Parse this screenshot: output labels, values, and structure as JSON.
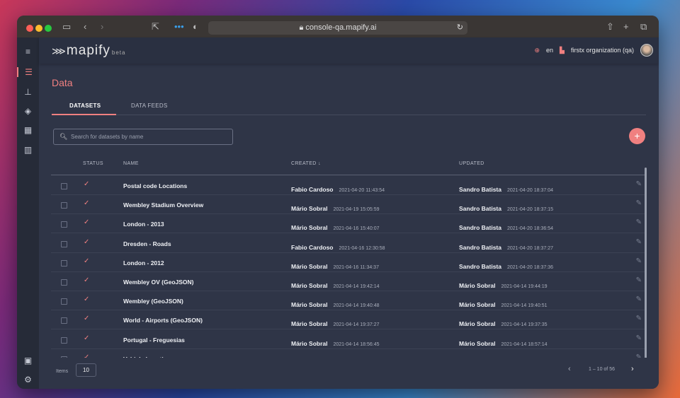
{
  "browser": {
    "url": "console-qa.mapify.ai"
  },
  "app": {
    "logo": "mapify",
    "logo_sub": "beta",
    "language": "en",
    "organization": "firstx organization (qa)"
  },
  "page": {
    "title": "Data",
    "tabs": [
      {
        "label": "DATASETS",
        "active": true
      },
      {
        "label": "DATA FEEDS",
        "active": false
      }
    ],
    "search_placeholder": "Search for datasets by name",
    "add_label": "+"
  },
  "table": {
    "headers": {
      "status": "STATUS",
      "name": "NAME",
      "created": "CREATED",
      "updated": "UPDATED"
    },
    "rows": [
      {
        "name": "Postal code Locations",
        "created_by": "Fabio Cardoso",
        "created_at": "2021-04-20 11:43:54",
        "updated_by": "Sandro Batista",
        "updated_at": "2021-04-20 18:37:04"
      },
      {
        "name": "Wembley Stadium Overview",
        "created_by": "Mário Sobral",
        "created_at": "2021-04-19 15:05:59",
        "updated_by": "Sandro Batista",
        "updated_at": "2021-04-20 18:37:15"
      },
      {
        "name": "London - 2013",
        "created_by": "Mário Sobral",
        "created_at": "2021-04-16 15:40:07",
        "updated_by": "Sandro Batista",
        "updated_at": "2021-04-20 18:36:54"
      },
      {
        "name": "Dresden - Roads",
        "created_by": "Fabio Cardoso",
        "created_at": "2021-04-16 12:30:58",
        "updated_by": "Sandro Batista",
        "updated_at": "2021-04-20 18:37:27"
      },
      {
        "name": "London - 2012",
        "created_by": "Mário Sobral",
        "created_at": "2021-04-16 11:34:37",
        "updated_by": "Sandro Batista",
        "updated_at": "2021-04-20 18:37:36"
      },
      {
        "name": "Wembley OV (GeoJSON)",
        "created_by": "Mário Sobral",
        "created_at": "2021-04-14 19:42:14",
        "updated_by": "Mário Sobral",
        "updated_at": "2021-04-14 19:44:19"
      },
      {
        "name": "Wembley (GeoJSON)",
        "created_by": "Mário Sobral",
        "created_at": "2021-04-14 19:40:48",
        "updated_by": "Mário Sobral",
        "updated_at": "2021-04-14 19:40:51"
      },
      {
        "name": "World - Airports (GeoJSON)",
        "created_by": "Mário Sobral",
        "created_at": "2021-04-14 19:37:27",
        "updated_by": "Mário Sobral",
        "updated_at": "2021-04-14 19:37:35"
      },
      {
        "name": "Portugal - Freguesias",
        "created_by": "Mário Sobral",
        "created_at": "2021-04-14 18:56:45",
        "updated_by": "Mário Sobral",
        "updated_at": "2021-04-14 18:57:14"
      },
      {
        "name": "Vehicle Locations",
        "created_by": "Mário Sobral",
        "created_at": "",
        "updated_by": "Mário Sobral",
        "updated_at": ""
      }
    ]
  },
  "pagination": {
    "items_label": "Items",
    "items_per_page": "10",
    "range": "1 – 10 of 56"
  },
  "colors": {
    "accent": "#f08080",
    "background": "#2f3547",
    "sidebar": "#262b38"
  }
}
